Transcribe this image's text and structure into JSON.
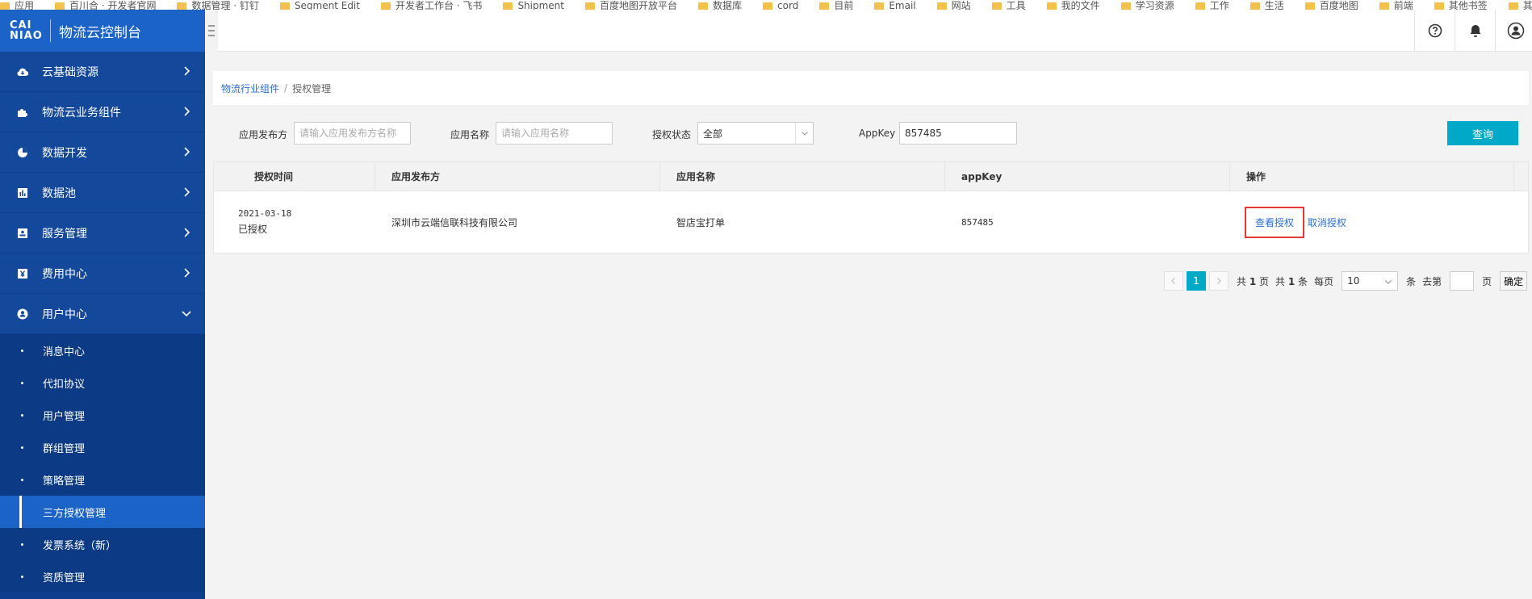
{
  "bookmarks": [
    "应用",
    "百川合 · 开发者官网",
    "数据管理 · 钉钉",
    "Segment Edit",
    "开发者工作台 · 飞书",
    "Shipment",
    "百度地图开放平台",
    "数据库",
    "cord",
    "目前",
    "Email",
    "网站",
    "工具",
    "我的文件",
    "学习资源",
    "工作",
    "生活",
    "百度地图",
    "前端",
    "其他书签",
    "其它书签"
  ],
  "brand": {
    "logo_line1": "CAI",
    "logo_line2": "NIAO",
    "title": "物流云控制台"
  },
  "sidebar": {
    "menus": [
      {
        "label": "云基础资源",
        "icon": "cloud-icon"
      },
      {
        "label": "物流云业务组件",
        "icon": "puzzle-icon"
      },
      {
        "label": "数据开发",
        "icon": "pie-chart-icon"
      },
      {
        "label": "数据池",
        "icon": "bar-chart-icon"
      },
      {
        "label": "服务管理",
        "icon": "id-card-icon"
      },
      {
        "label": "费用中心",
        "icon": "yen-icon"
      },
      {
        "label": "用户中心",
        "icon": "user-icon"
      }
    ],
    "sub_items": [
      "消息中心",
      "代扣协议",
      "用户管理",
      "群组管理",
      "策略管理",
      "三方授权管理",
      "发票系统（新）",
      "资质管理"
    ]
  },
  "breadcrumb": {
    "parent": "物流行业组件",
    "separator": "/",
    "current": "授权管理"
  },
  "filters": {
    "publisher_label": "应用发布方",
    "publisher_placeholder": "请输入应用发布方名称",
    "app_name_label": "应用名称",
    "app_name_placeholder": "请输入应用名称",
    "status_label": "授权状态",
    "status_value": "全部",
    "appkey_label": "AppKey",
    "appkey_value": "857485",
    "query_button": "查询"
  },
  "table": {
    "columns": [
      "授权时间",
      "应用发布方",
      "应用名称",
      "appKey",
      "操作"
    ],
    "rows": [
      {
        "auth_date": "2021-03-18",
        "auth_status": "已授权",
        "publisher": "深圳市云端信联科技有限公司",
        "app_name": "智店宝打单",
        "appkey": "857485",
        "action_view": "查看授权",
        "action_cancel": "取消授权"
      }
    ]
  },
  "pagination": {
    "current_page": "1",
    "total_pages_prefix": "共",
    "total_pages": "1",
    "total_pages_suffix": "页",
    "total_items_prefix": "共",
    "total_items": "1",
    "total_items_suffix": "条",
    "per_page_label": "每页",
    "per_page_value": "10",
    "per_page_unit": "条",
    "jump_label": "去第",
    "jump_unit": "页",
    "confirm_button": "确定"
  },
  "colors": {
    "sidebar_bg": "#0f3e8c",
    "brand_bg": "#1b63c6",
    "accent": "#00a9c8",
    "link": "#2d6fd8",
    "highlight_box": "#e53935"
  }
}
